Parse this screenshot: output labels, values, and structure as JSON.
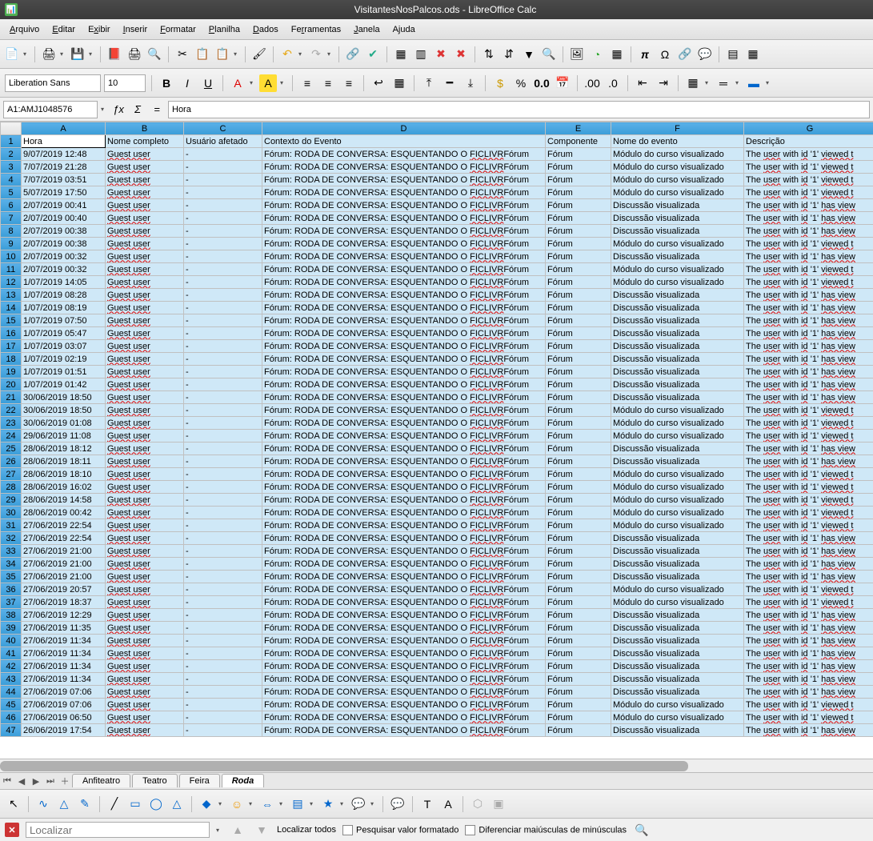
{
  "window": {
    "title": "VisitantesNosPalcos.ods - LibreOffice Calc",
    "app_icon": "📊"
  },
  "menus": [
    {
      "l": "Arquivo",
      "u": 0
    },
    {
      "l": "Editar",
      "u": 0
    },
    {
      "l": "Exibir",
      "u": 1
    },
    {
      "l": "Inserir",
      "u": 0
    },
    {
      "l": "Formatar",
      "u": 0
    },
    {
      "l": "Planilha",
      "u": 0
    },
    {
      "l": "Dados",
      "u": 0
    },
    {
      "l": "Ferramentas",
      "u": 2
    },
    {
      "l": "Janela",
      "u": 0
    },
    {
      "l": "Ajuda",
      "u": 1
    }
  ],
  "font": {
    "name": "Liberation Sans",
    "size": "10"
  },
  "namebox": "A1:AMJ1048576",
  "formula_cell": "Hora",
  "columns": [
    "A",
    "B",
    "C",
    "D",
    "E",
    "F",
    "G"
  ],
  "headers": [
    "Hora",
    "Nome completo",
    "Usuário afetado",
    "Contexto do Evento",
    "Componente",
    "Nome do evento",
    "Descrição"
  ],
  "tabs": {
    "items": [
      "Anfiteatro",
      "Teatro",
      "Feira",
      "Roda"
    ],
    "active": 3
  },
  "find": {
    "placeholder": "Localizar",
    "all": "Localizar todos",
    "fmt": "Pesquisar valor formatado",
    "case": "Diferenciar maiúsculas de minúsculas"
  },
  "common": {
    "guest": "Guest user",
    "dash": "-",
    "ctx": "Fórum: RODA DE CONVERSA: ESQUENTANDO O FICLIVRFórum",
    "ctx_pre": "Fórum: RODA DE CONVERSA: ESQUENTANDO O ",
    "ctx_tail": "FICLIVR",
    "comp": "Fórum",
    "e1": "Módulo do curso visualizado",
    "e2": "Discussão visualizada",
    "d_pre": "The ",
    "d_user": "user",
    "d_mid": " with ",
    "d_id": "id",
    "d_end": " '1' ",
    "d_v": "viewed t",
    "d_h": "has view"
  },
  "rows": [
    {
      "t": "9/07/2019 12:48",
      "e": 1,
      "d": 1
    },
    {
      "t": "7/07/2019 21:28",
      "e": 1,
      "d": 1
    },
    {
      "t": "7/07/2019 03:51",
      "e": 1,
      "d": 1
    },
    {
      "t": "5/07/2019 17:50",
      "e": 1,
      "d": 1
    },
    {
      "t": "2/07/2019 00:41",
      "e": 2,
      "d": 2
    },
    {
      "t": "2/07/2019 00:40",
      "e": 2,
      "d": 2
    },
    {
      "t": "2/07/2019 00:38",
      "e": 2,
      "d": 2
    },
    {
      "t": "2/07/2019 00:38",
      "e": 1,
      "d": 1
    },
    {
      "t": "2/07/2019 00:32",
      "e": 2,
      "d": 2
    },
    {
      "t": "2/07/2019 00:32",
      "e": 1,
      "d": 1
    },
    {
      "t": "1/07/2019 14:05",
      "e": 1,
      "d": 1
    },
    {
      "t": "1/07/2019 08:28",
      "e": 2,
      "d": 2
    },
    {
      "t": "1/07/2019 08:19",
      "e": 2,
      "d": 2
    },
    {
      "t": "1/07/2019 07:50",
      "e": 2,
      "d": 2
    },
    {
      "t": "1/07/2019 05:47",
      "e": 2,
      "d": 2
    },
    {
      "t": "1/07/2019 03:07",
      "e": 2,
      "d": 2
    },
    {
      "t": "1/07/2019 02:19",
      "e": 2,
      "d": 2
    },
    {
      "t": "1/07/2019 01:51",
      "e": 2,
      "d": 2
    },
    {
      "t": "1/07/2019 01:42",
      "e": 2,
      "d": 2
    },
    {
      "t": "30/06/2019 18:50",
      "e": 2,
      "d": 2
    },
    {
      "t": "30/06/2019 18:50",
      "e": 1,
      "d": 1
    },
    {
      "t": "30/06/2019 01:08",
      "e": 1,
      "d": 1
    },
    {
      "t": "29/06/2019 11:08",
      "e": 1,
      "d": 1
    },
    {
      "t": "28/06/2019 18:12",
      "e": 2,
      "d": 2
    },
    {
      "t": "28/06/2019 18:11",
      "e": 2,
      "d": 2
    },
    {
      "t": "28/06/2019 18:10",
      "e": 1,
      "d": 1
    },
    {
      "t": "28/06/2019 16:02",
      "e": 1,
      "d": 1
    },
    {
      "t": "28/06/2019 14:58",
      "e": 1,
      "d": 1
    },
    {
      "t": "28/06/2019 00:42",
      "e": 1,
      "d": 1
    },
    {
      "t": "27/06/2019 22:54",
      "e": 1,
      "d": 1
    },
    {
      "t": "27/06/2019 22:54",
      "e": 2,
      "d": 2
    },
    {
      "t": "27/06/2019 21:00",
      "e": 2,
      "d": 2
    },
    {
      "t": "27/06/2019 21:00",
      "e": 2,
      "d": 2
    },
    {
      "t": "27/06/2019 21:00",
      "e": 2,
      "d": 2
    },
    {
      "t": "27/06/2019 20:57",
      "e": 1,
      "d": 1
    },
    {
      "t": "27/06/2019 18:37",
      "e": 1,
      "d": 1
    },
    {
      "t": "27/06/2019 12:29",
      "e": 2,
      "d": 2
    },
    {
      "t": "27/06/2019 11:35",
      "e": 2,
      "d": 2
    },
    {
      "t": "27/06/2019 11:34",
      "e": 2,
      "d": 2
    },
    {
      "t": "27/06/2019 11:34",
      "e": 2,
      "d": 2
    },
    {
      "t": "27/06/2019 11:34",
      "e": 2,
      "d": 2
    },
    {
      "t": "27/06/2019 11:34",
      "e": 2,
      "d": 2
    },
    {
      "t": "27/06/2019 07:06",
      "e": 2,
      "d": 2
    },
    {
      "t": "27/06/2019 07:06",
      "e": 1,
      "d": 1
    },
    {
      "t": "27/06/2019 06:50",
      "e": 1,
      "d": 1
    },
    {
      "t": "26/06/2019 17:54",
      "e": 2,
      "d": 2
    }
  ]
}
